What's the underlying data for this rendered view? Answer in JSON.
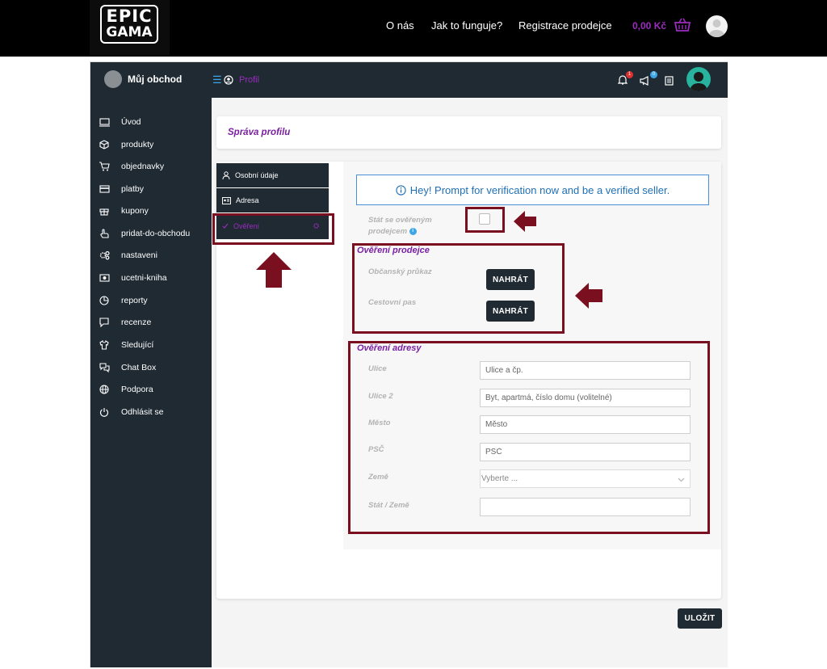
{
  "site": {
    "logo_line1": "EPIC",
    "logo_line2": "GAMA",
    "nav": [
      "O nás",
      "Jak to funguje?",
      "Registrace prodejce"
    ],
    "cart_amount": "0,00 Kč"
  },
  "app_header": {
    "store_name": "Můj obchod",
    "breadcrumb": "Profil",
    "notifications_count": "1",
    "announcements_count": "0"
  },
  "sidebar": {
    "items": [
      {
        "label": "Úvod",
        "icon": "monitor-icon"
      },
      {
        "label": "produkty",
        "icon": "box-icon"
      },
      {
        "label": "objednavky",
        "icon": "cart-icon"
      },
      {
        "label": "platby",
        "icon": "credit-card-icon"
      },
      {
        "label": "kupony",
        "icon": "gift-icon"
      },
      {
        "label": "pridat-do-obchodu",
        "icon": "hand-pointer-icon"
      },
      {
        "label": "nastaveni",
        "icon": "gears-icon"
      },
      {
        "label": "ucetni-kniha",
        "icon": "money-icon"
      },
      {
        "label": "reporty",
        "icon": "pie-chart-icon"
      },
      {
        "label": "recenze",
        "icon": "comment-icon"
      },
      {
        "label": "Sledující",
        "icon": "shirt-icon"
      },
      {
        "label": "Chat Box",
        "icon": "chat-icon"
      },
      {
        "label": "Podpora",
        "icon": "globe-icon"
      },
      {
        "label": "Odhlásit se",
        "icon": "power-icon"
      }
    ]
  },
  "page": {
    "title": "Správa profilu",
    "tabs": [
      {
        "label": "Osobní údaje",
        "icon": "user-icon"
      },
      {
        "label": "Adresa",
        "icon": "address-card-icon"
      },
      {
        "label": "Ověření",
        "icon": "check-icon",
        "active": true
      }
    ],
    "alert": "Hey! Prompt for verification now and be a verified seller.",
    "verified_seller_label_1": "Stát se ověřeným",
    "verified_seller_label_2": "prodejcem",
    "verified_seller_checked": false,
    "seller_verification": {
      "title": "Ověření prodejce",
      "id_card_label": "Občanský průkaz",
      "passport_label": "Cestovní pas",
      "upload_label": "NAHRÁT"
    },
    "address_verification": {
      "title": "Ověření adresy",
      "street_label": "Ulice",
      "street_placeholder": "Ulice a čp.",
      "street2_label": "Ulice 2",
      "street2_placeholder": "Byt, apartmá, číslo domu (volitelné)",
      "city_label": "Město",
      "city_placeholder": "Město",
      "zip_label": "PSČ",
      "zip_placeholder": "PSČ",
      "country_label": "Země",
      "country_selected": "Vyberte ...",
      "state_label": "Stát / Země",
      "state_value": ""
    },
    "save_label": "ULOŽIT"
  },
  "colors": {
    "dark": "#1f2a33",
    "accent_purple": "#9b2cbf",
    "annotation": "#7a0f1f",
    "info_blue": "#1f6fb5"
  }
}
